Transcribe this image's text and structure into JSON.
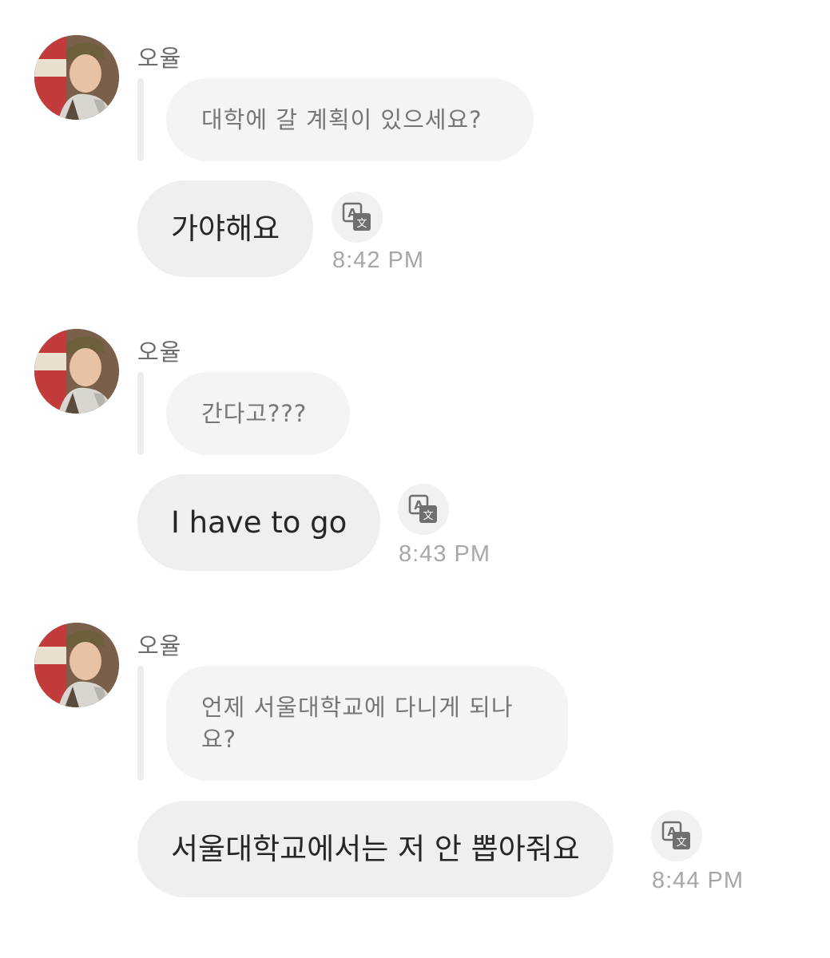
{
  "messages": [
    {
      "sender": "오율",
      "quoted": "대학에 갈 계획이 있으세요?",
      "reply": "가야해요",
      "time": "8:42 PM"
    },
    {
      "sender": "오율",
      "quoted": "간다고???",
      "reply": "I have to go",
      "time": "8:43 PM"
    },
    {
      "sender": "오율",
      "quoted_line1": "언제 서울대학교에 다니게 되나",
      "quoted_line2": "요?",
      "reply": "서울대학교에서는 저 안 뽑아줘요",
      "time": "8:44 PM"
    }
  ],
  "icons": {
    "avatar": "profile-photo",
    "translate": "translate-icon"
  },
  "colors": {
    "quoted_bubble": "#f4f4f7",
    "reply_bubble": "#efeff2",
    "timestamp": "#a6a6ab",
    "sender": "#6b6b6b"
  }
}
